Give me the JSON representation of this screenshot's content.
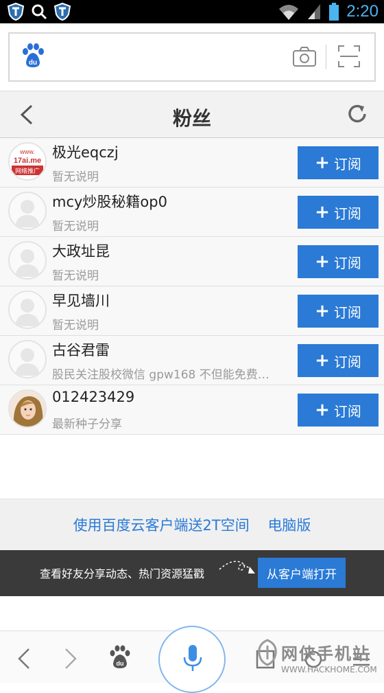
{
  "status_bar": {
    "time": "2:20"
  },
  "header": {
    "title": "粉丝"
  },
  "subscribe_label": "订阅",
  "fans": [
    {
      "name": "极光eqczj",
      "desc": "暂无说明",
      "avatar": "logo"
    },
    {
      "name": "mcy炒股秘籍op0",
      "desc": "暂无说明",
      "avatar": "default"
    },
    {
      "name": "大政址昆",
      "desc": "暂无说明",
      "avatar": "default"
    },
    {
      "name": "早见墙川",
      "desc": "暂无说明",
      "avatar": "default"
    },
    {
      "name": "古谷君雷",
      "desc": "股民关注股校微信 gpw168 不但能免费…",
      "avatar": "default"
    },
    {
      "name": "012423429",
      "desc": "最新种子分享",
      "avatar": "photo"
    }
  ],
  "avatar_logo_text": [
    "www.",
    "17ai.me",
    "网络推广"
  ],
  "promo": {
    "client_link": "使用百度云客户端送2T空间",
    "pc_link": "电脑版"
  },
  "banner": {
    "text": "查看好友分享动态、热门资源猛戳",
    "button": "从客户端打开"
  },
  "watermark": {
    "line1": "网侠手机站",
    "line2": "WWW.HACKHOME.COM"
  },
  "colors": {
    "accent": "#2a7ad6",
    "banner_bg": "#3a3a3a"
  }
}
